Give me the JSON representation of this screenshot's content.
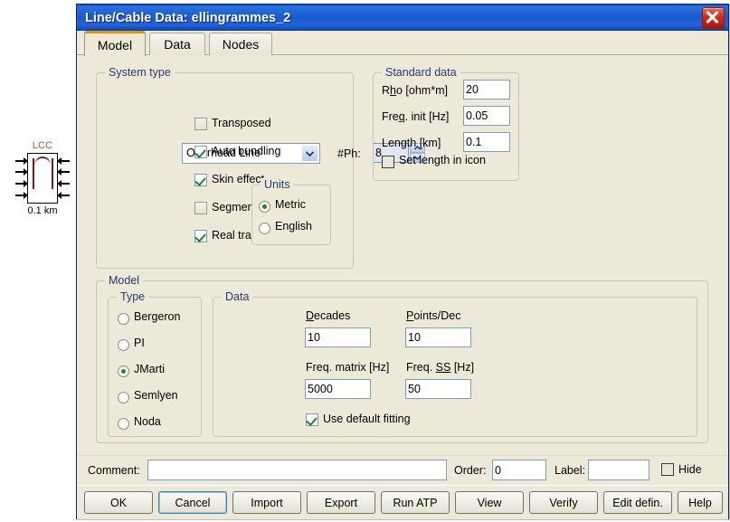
{
  "canvas": {
    "component": {
      "name": "LCC",
      "length_label": "0.1 km",
      "label_color": "#b05030"
    }
  },
  "window": {
    "title": "Line/Cable Data: ellingrammes_2",
    "close_icon": "close-icon",
    "titlebar_color": "#1a5fd2"
  },
  "tabs": [
    {
      "label": "Model",
      "active": true
    },
    {
      "label": "Data",
      "active": false
    },
    {
      "label": "Nodes",
      "active": false
    }
  ],
  "system_type": {
    "group_label": "System type",
    "combo_value": "Overhead Line",
    "combo_icon": "chevron-down-icon",
    "phases_label": "#Ph:",
    "phases_value": "8",
    "spinner_up_icon": "chevron-up-icon",
    "spinner_down_icon": "chevron-down-icon",
    "checkboxes": [
      {
        "label": "Transposed",
        "checked": false
      },
      {
        "label": "Auto bundling",
        "checked": true
      },
      {
        "label": "Skin effect",
        "checked": true
      },
      {
        "label": "Segmented ground",
        "checked": false
      },
      {
        "label": "Real transf. matrix",
        "checked": true
      }
    ],
    "units": {
      "group_label": "Units",
      "options": [
        {
          "label": "Metric",
          "selected": true
        },
        {
          "label": "English",
          "selected": false
        }
      ]
    }
  },
  "standard_data": {
    "group_label": "Standard data",
    "fields": [
      {
        "label": "Rho [ohm*m]",
        "value": "20"
      },
      {
        "label": "Freq. init [Hz]",
        "value": "0.05"
      },
      {
        "label": "Length [km]",
        "value": "0.1"
      }
    ],
    "set_length_in_icon": {
      "label": "Set length in icon",
      "checked": false
    }
  },
  "model": {
    "group_label": "Model",
    "type": {
      "group_label": "Type",
      "options": [
        {
          "label": "Bergeron",
          "selected": false
        },
        {
          "label": "PI",
          "selected": false
        },
        {
          "label": "JMarti",
          "selected": true
        },
        {
          "label": "Semlyen",
          "selected": false
        },
        {
          "label": "Noda",
          "selected": false
        }
      ]
    },
    "data": {
      "group_label": "Data",
      "fields": [
        {
          "label": "Decades",
          "value": "10"
        },
        {
          "label": "Points/Dec",
          "value": "10"
        },
        {
          "label": "Freq. matrix [Hz]",
          "value": "5000"
        },
        {
          "label": "Freq. SS [Hz]",
          "value": "50"
        }
      ],
      "use_default_fitting": {
        "label": "Use default fitting",
        "checked": true
      }
    }
  },
  "footer": {
    "comment_label": "Comment:",
    "comment_value": "",
    "order_label": "Order:",
    "order_value": "0",
    "label_label": "Label:",
    "label_value": "",
    "hide_label": "Hide",
    "hide_checked": false
  },
  "buttons": [
    {
      "label": "OK",
      "focused": false
    },
    {
      "label": "Cancel",
      "focused": true
    },
    {
      "label": "Import",
      "focused": false
    },
    {
      "label": "Export",
      "focused": false
    },
    {
      "label": "Run ATP",
      "focused": false
    },
    {
      "label": "View",
      "focused": false
    },
    {
      "label": "Verify",
      "focused": false
    },
    {
      "label": "Edit defin.",
      "focused": false
    },
    {
      "label": "Help",
      "focused": false
    }
  ]
}
